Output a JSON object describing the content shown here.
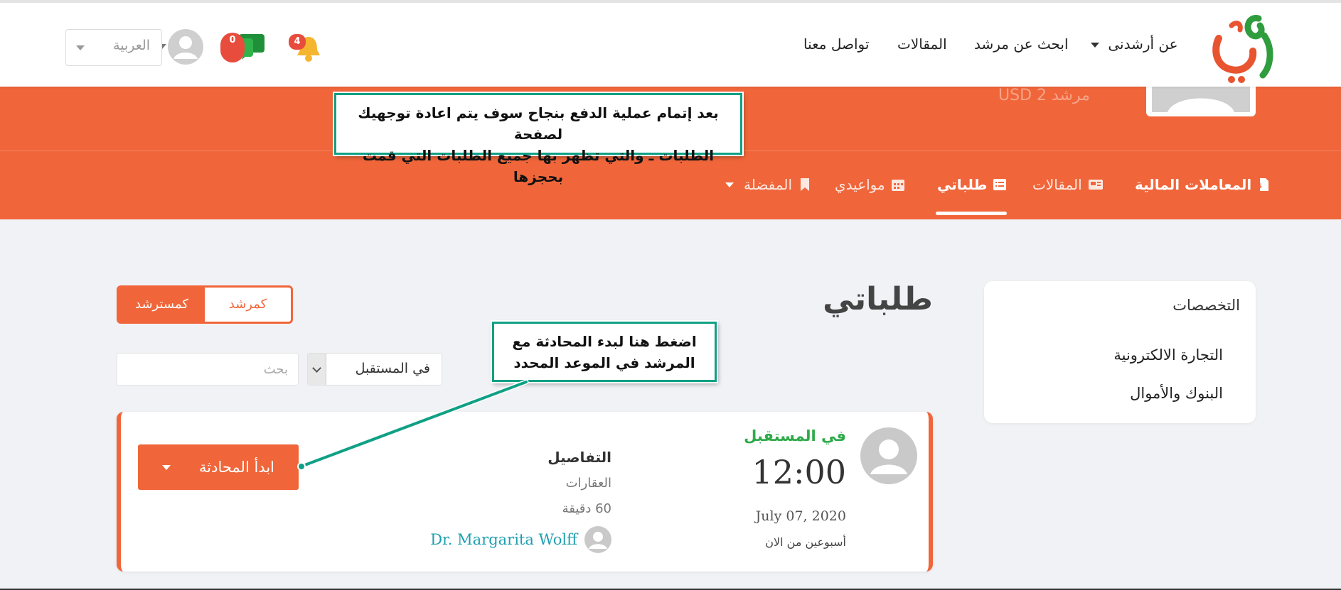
{
  "header": {
    "nav": {
      "about": "عن أرشدنى",
      "find_mentor": "ابحث عن مرشد",
      "articles": "المقالات",
      "contact": "تواصل معنا"
    },
    "notifications_count": "4",
    "messages_count": "0",
    "language": "العربية"
  },
  "band": {
    "ghost_text": "مرشد  USD 2",
    "tabs": {
      "transactions": "المعاملات المالية",
      "articles": "المقالات",
      "requests": "طلباتي",
      "appointments": "مواعيدي",
      "favorites": "المفضلة"
    }
  },
  "callouts": {
    "payment_line1": "بعد إتمام عملية الدفع بنجاح سوف يتم اعادة توجهيك لصفحة",
    "payment_line2": "الطلبات ـ والتي تظهر بها جميع الطلبات التي قمت بحجزها",
    "start_line1": "اضغط هنا لبدء المحادثة مع",
    "start_line2": "المرشد في الموعد المحدد"
  },
  "sidebar": {
    "title": "التخصصات",
    "items": [
      "التجارة الالكترونية",
      "البنوك والأموال"
    ]
  },
  "main": {
    "title": "طلباتي",
    "toggle": {
      "as_mentor": "كمرشد",
      "as_mentee": "كمسترشد"
    },
    "filter_value": "في المستقبل",
    "search_placeholder": "بحث"
  },
  "booking": {
    "status": "في المستقبل",
    "time": "12:00",
    "date": "July 07, 2020",
    "relative": "أسبوعين من الان",
    "details_title": "التفاصيل",
    "specialty": "العقارات",
    "duration": "60 دقيقة",
    "mentor_name": "Dr. Margarita Wolff",
    "start_button": "ابدأ المحادثة"
  },
  "colors": {
    "accent": "#f0663a",
    "callout_border": "#10a085",
    "status_green": "#2eaa4a",
    "mentor_link": "#1e9fb0"
  }
}
